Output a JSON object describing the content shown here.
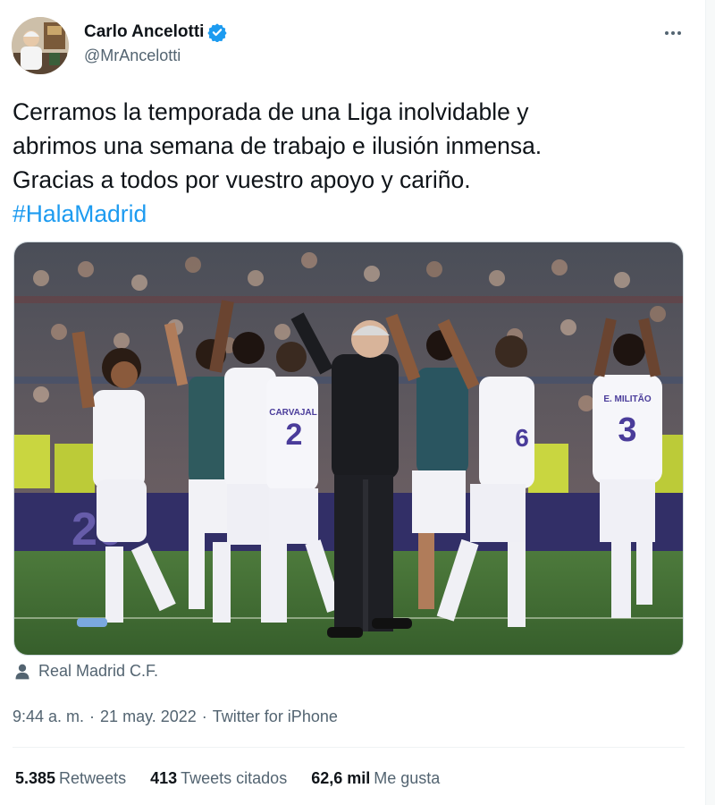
{
  "author": {
    "name": "Carlo Ancelotti",
    "handle": "@MrAncelotti"
  },
  "tweet": {
    "lines": [
      "Cerramos la temporada de una Liga inolvidable y",
      "abrimos una semana de trabajo e ilusión inmensa.",
      "Gracias a todos por vuestro apoyo y cariño."
    ],
    "hashtag": "#HalaMadrid"
  },
  "media": {
    "jerseys": [
      "2",
      "3"
    ],
    "jersey_names": [
      "CARVAJAL",
      "E. MILITÃO"
    ],
    "ad_board": "20"
  },
  "tagged": {
    "label": "Real Madrid C.F."
  },
  "meta": {
    "time": "9:44 a. m.",
    "sep1": "·",
    "date": "21 may. 2022",
    "sep2": "·",
    "source": "Twitter for iPhone"
  },
  "stats": {
    "retweets_count": "5.385",
    "retweets_label": "Retweets",
    "quotes_count": "413",
    "quotes_label": "Tweets citados",
    "likes_count": "62,6 mil",
    "likes_label": "Me gusta"
  },
  "colors": {
    "accent": "#1d9bf0",
    "text": "#0f1419",
    "secondary": "#536471",
    "pitch": "#3f6a33"
  },
  "icons": {
    "verified": "verified-badge-icon",
    "more": "more-options-icon",
    "tag": "person-tag-icon"
  }
}
